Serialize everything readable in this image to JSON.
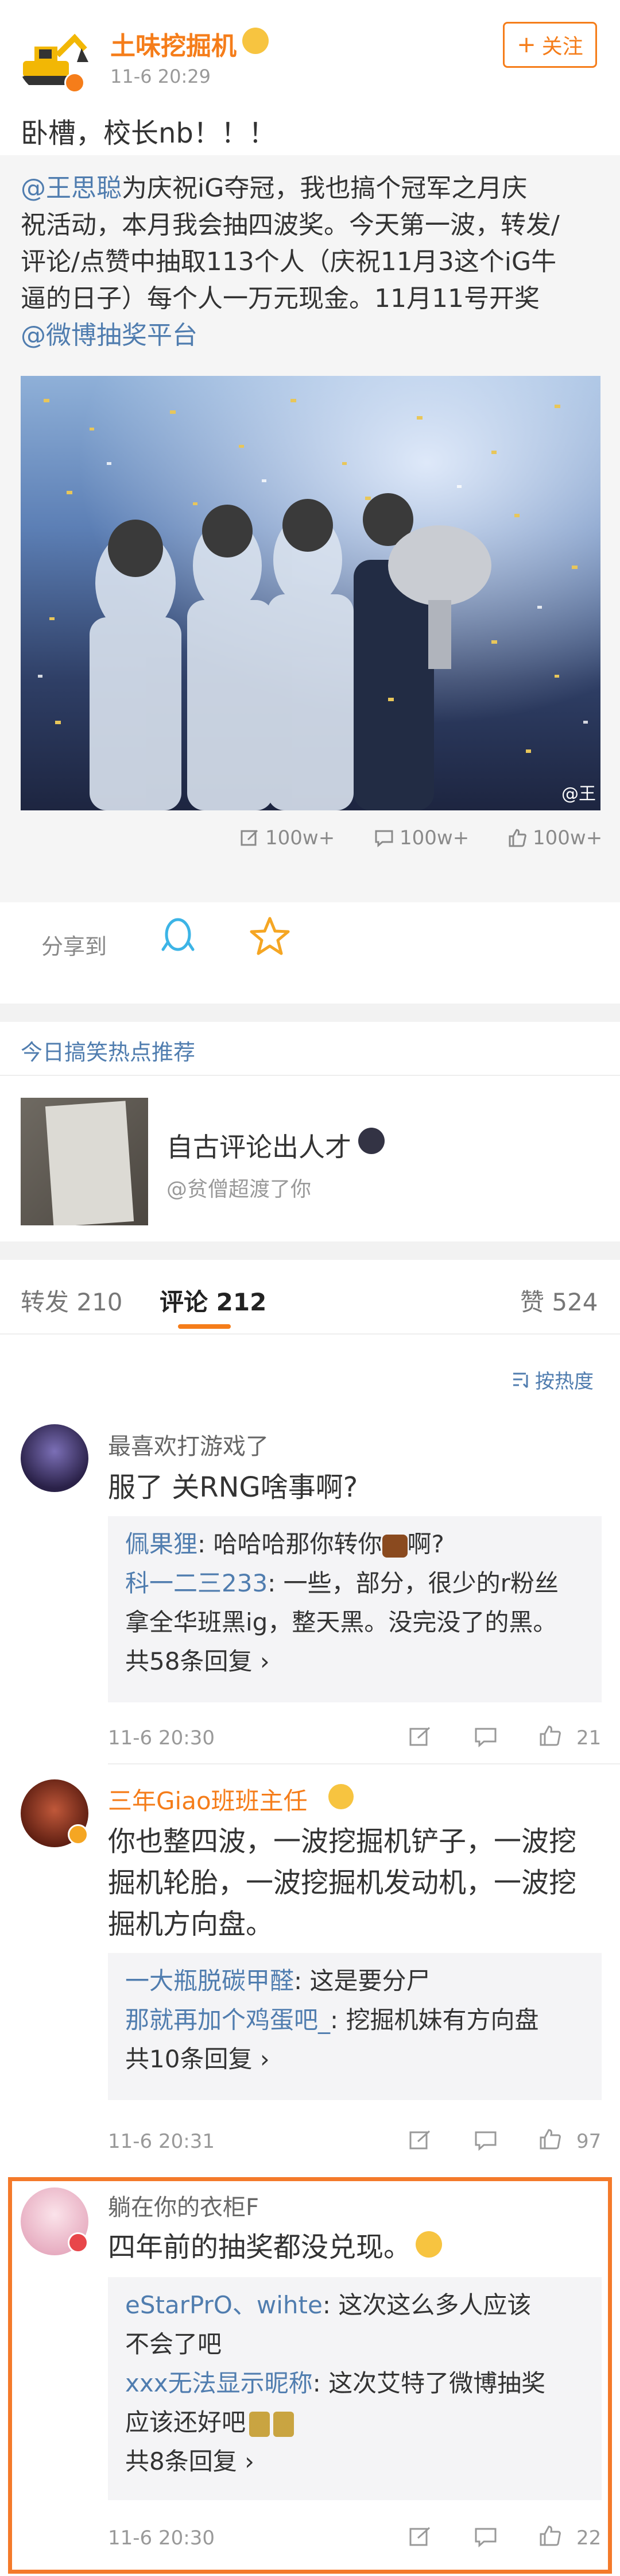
{
  "post": {
    "author": "土味挖掘机",
    "time": "11-6 20:29",
    "follow_label": "关注",
    "text": "卧槽，校长nb！！！"
  },
  "repost": {
    "author_mention": "@王思聪",
    "line1": "为庆祝iG夺冠，我也搞个冠军之月庆",
    "line2": "祝活动，本月我会抽四波奖。今天第一波，转发/",
    "line3": "评论/点赞中抽取113个人（庆祝11月3这个iG牛",
    "line4": "逼的日子）每个人一万元现金。11月11号开奖",
    "mention2": "@微博抽奖平台",
    "image_watermark": "@王",
    "stats": {
      "reposts": "100w+",
      "comments": "100w+",
      "likes": "100w+"
    }
  },
  "share": {
    "label": "分享到"
  },
  "hot": {
    "header": "今日搞笑热点推荐",
    "title": "自古评论出人才",
    "author": "@贫僧超渡了你"
  },
  "tabs": {
    "repost": "转发 210",
    "comment": "评论 212",
    "like": "赞 524"
  },
  "sort_label": "按热度",
  "comments": [
    {
      "author": "最喜欢打游戏了",
      "text": "服了 关RNG啥事啊?",
      "replies": [
        {
          "name": "佩果狸",
          "text": ": 哈哈哈那你转你",
          "tail": "啊?"
        },
        {
          "name": "科一二三233",
          "text": ": 一些，部分，很少的r粉丝",
          "text2": "拿全华班黑ig，整天黑。没完没了的黑。"
        }
      ],
      "more": "共58条回复",
      "time": "11-6 20:30",
      "likes": "21"
    },
    {
      "author": "三年Giao班班主任",
      "text1": "你也整四波，一波挖掘机铲子，一波挖",
      "text2": "掘机轮胎，一波挖掘机发动机，一波挖",
      "text3": "掘机方向盘。",
      "replies": [
        {
          "name": "一大瓶脱碳甲醛",
          "text": ": 这是要分尸"
        },
        {
          "name": "那就再加个鸡蛋吧_",
          "text": ": 挖掘机妹有方向盘"
        }
      ],
      "more": "共10条回复",
      "time": "11-6 20:31",
      "likes": "97"
    },
    {
      "author": "躺在你的衣柜F",
      "text": "四年前的抽奖都没兑现。",
      "replies": [
        {
          "name": "eStarPrO、wihte",
          "text": ": 这次这么多人应该",
          "text2": "不会了吧"
        },
        {
          "name": "xxx无法显示昵称",
          "text": ": 这次艾特了微博抽奖",
          "text2": "应该还好吧"
        }
      ],
      "more": "共8条回复",
      "time": "11-6 20:30",
      "likes": "22"
    }
  ],
  "colors": {
    "orange": "#f57d1a",
    "blue": "#507daf",
    "highlight": "#f47a2a"
  }
}
